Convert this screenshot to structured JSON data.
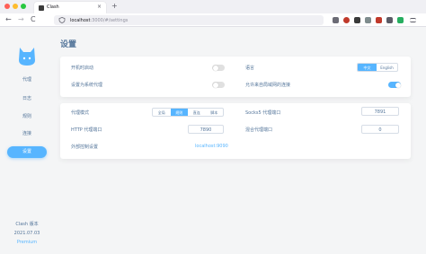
{
  "browser": {
    "tab_title": "Clash",
    "tab_close": "×",
    "new_tab": "+",
    "url_host": "localhost",
    "url_rest": ":3000/#/settings",
    "back": "←",
    "forward": "→",
    "reload": "C"
  },
  "sidebar": {
    "items": [
      {
        "label": "代理"
      },
      {
        "label": "日志"
      },
      {
        "label": "规则"
      },
      {
        "label": "连接"
      },
      {
        "label": "设置"
      }
    ],
    "active_index": 4,
    "version_label": "Clash 版本",
    "version_date": "2021.07.03",
    "premium": "Premium"
  },
  "page_title": "设置",
  "general": {
    "auto_start_label": "开机时启动",
    "auto_start_on": false,
    "language_label": "语言",
    "language_options": [
      "中文",
      "English"
    ],
    "language_selected": "中文",
    "system_proxy_label": "设置为系统代理",
    "system_proxy_on": false,
    "allow_lan_label": "允许来自局域网的连接",
    "allow_lan_on": true
  },
  "proxy": {
    "mode_label": "代理模式",
    "mode_options": [
      "全局",
      "规则",
      "直连",
      "脚本"
    ],
    "mode_selected": "规则",
    "socks5_label": "Socks5 代理端口",
    "socks5_value": "7891",
    "http_label": "HTTP 代理端口",
    "http_value": "7890",
    "mixed_label": "混合代理端口",
    "mixed_value": "0",
    "external_label": "外部控制设置",
    "external_value": "localhost:9090"
  },
  "colors": {
    "accent": "#57b5ff",
    "text": "#54759a",
    "background": "#f4f5f6"
  }
}
